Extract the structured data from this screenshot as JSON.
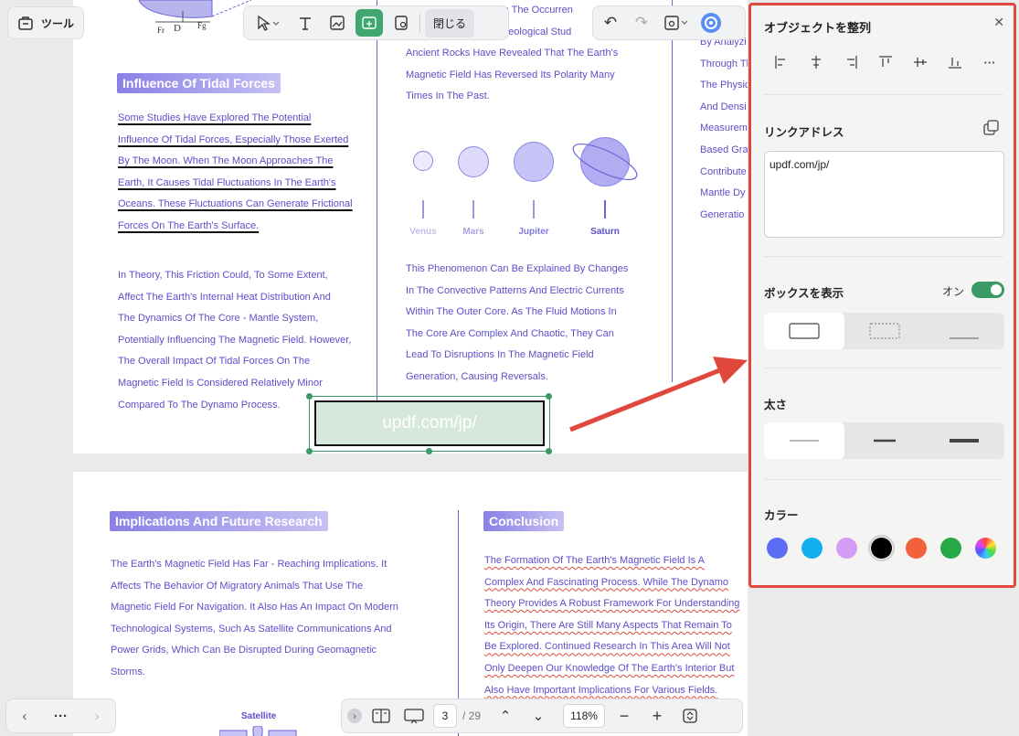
{
  "top_left": {
    "tools_label": "ツール"
  },
  "toolbar": {
    "close_label": "閉じる"
  },
  "page1": {
    "tidal_heading": "Influence Of Tidal Forces",
    "tidal_lines": [
      "Some Studies Have Explored The Potential ",
      "Influence Of Tidal Forces, Especially Those Exerted ",
      "By The Moon. When The Moon Approaches The ",
      "Earth, It Causes Tidal Fluctuations In The Earth's ",
      "Oceans. These Fluctuations Can Generate Frictional ",
      "Forces On The Earth's Surface."
    ],
    "theory_lines": [
      " In Theory, This Friction Could, To Some Extent,",
      "Affect The Earth's Internal Heat Distribution And",
      "The Dynamics Of The Core - Mantle System,",
      "Potentially Influencing The Magnetic Field. However,",
      "The Overall Impact Of Tidal Forces On The",
      "Magnetic Field Is Considered Relatively Minor",
      "Compared To The Dynamo Process."
    ],
    "mid_top_lines": [
      "ry Is The Occurren",
      "s. Geological Stud",
      "Ancient Rocks Have Revealed That The Earth's",
      "Magnetic Field Has Reversed Its Polarity Many",
      "Times In The Past."
    ],
    "planets": [
      "Venus",
      "Mars",
      "Jupiter",
      "Saturn"
    ],
    "mid_bottom_lines": [
      "This Phenomenon Can Be Explained By Changes",
      "In The Convective Patterns And Electric Currents",
      "Within The Outer Core. As The Fluid Motions In",
      "The Core Are Complex And Chaotic, They Can",
      "Lead To Disruptions In The Magnetic Field",
      "Generation, Causing Reversals."
    ],
    "right_lines": [
      "By Analyzi",
      "Through Th",
      "The Physic",
      "And Densi",
      "Measurem",
      "Based Gra",
      "Contribute",
      "Mantle Dy",
      "Generatio"
    ],
    "diagram_labels": {
      "fr": "Fr",
      "d": "D",
      "fg": "Fg"
    },
    "link_text": "updf.com/jp/"
  },
  "page2": {
    "impl_heading": "Implications And Future Research",
    "impl_lines": [
      "The Earth's Magnetic Field Has Far - Reaching Implications. It",
      "Affects The Behavior Of Migratory Animals That Use The",
      "Magnetic Field For Navigation. It Also Has An Impact On Modern",
      "Technological Systems, Such As Satellite Communications And",
      "Power Grids, Which Can Be Disrupted During Geomagnetic",
      "Storms."
    ],
    "satellite_label": "Satellite",
    "conclusion_heading": "Conclusion",
    "conclusion_lines": [
      "The Formation Of The Earth's Magnetic Field Is A",
      "Complex And Fascinating Process. While The Dynamo",
      "Theory Provides A Robust Framework For Understanding",
      "Its Origin, There Are Still Many Aspects That Remain To",
      "Be Explored. Continued Research In This Area Will Not",
      "Only Deepen Our Knowledge Of The Earth's Interior But",
      "Also Have Important Implications For Various Fields."
    ]
  },
  "bottom_bar": {
    "page_current": "3",
    "page_total": "/ 29",
    "zoom": "118%"
  },
  "panel": {
    "title": "オブジェクトを整列",
    "link_label": "リンクアドレス",
    "link_value": "updf.com/jp/",
    "box_label": "ボックスを表示",
    "box_state": "オン",
    "weight_label": "太さ",
    "color_label": "カラー",
    "colors": [
      "#5b6cf5",
      "#12aef0",
      "#d59cf5",
      "#000000",
      "#f2603c",
      "#27a846",
      "conic"
    ],
    "selected_color_index": 3
  },
  "accent_green": "#3fa76f",
  "highlight_red": "#e0483d"
}
